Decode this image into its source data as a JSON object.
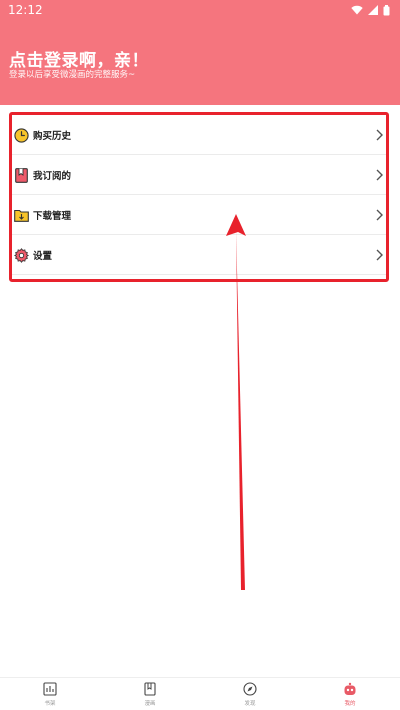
{
  "status_bar": {
    "time": "12:12"
  },
  "header": {
    "title": "点击登录啊，亲！",
    "subtitle": "登录以后享受微漫画的完整服务~"
  },
  "menu": [
    {
      "label": "购买历史",
      "icon": "clock-icon"
    },
    {
      "label": "我订阅的",
      "icon": "bookmark-icon"
    },
    {
      "label": "下载管理",
      "icon": "download-folder-icon"
    },
    {
      "label": "设置",
      "icon": "gear-icon"
    }
  ],
  "bottom_nav": [
    {
      "label": "书架",
      "icon": "bookshelf-icon",
      "active": false
    },
    {
      "label": "漫画",
      "icon": "book-icon",
      "active": false
    },
    {
      "label": "发现",
      "icon": "compass-icon",
      "active": false
    },
    {
      "label": "我的",
      "icon": "robot-avatar-icon",
      "active": true
    }
  ],
  "colors": {
    "header_bg": "#f5757e",
    "highlight_border": "#e8222c",
    "active_tab": "#e85a66"
  }
}
